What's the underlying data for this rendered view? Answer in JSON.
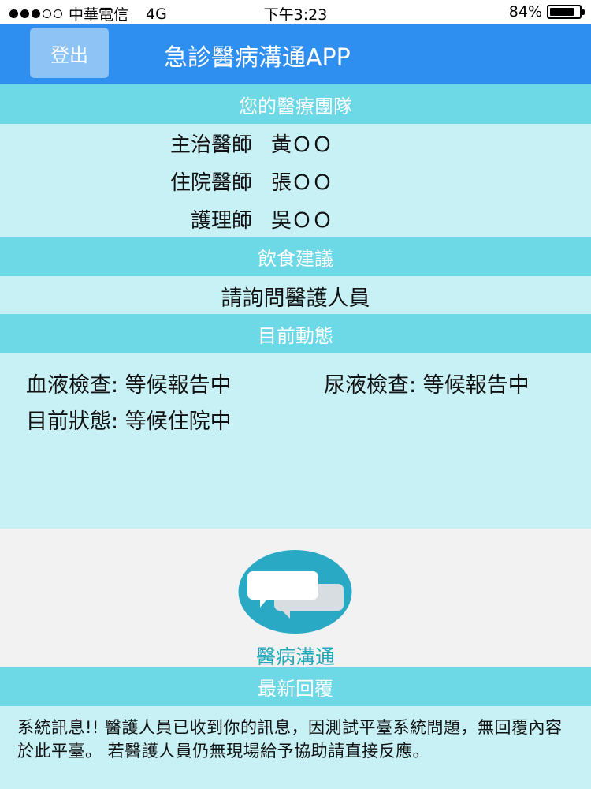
{
  "status_bar": {
    "carrier": "中華電信",
    "network": "4G",
    "time": "下午3:23",
    "battery_percent": "84%",
    "battery_level": 0.84,
    "signal_strength": 3
  },
  "header": {
    "logout_label": "登出",
    "title": "急診醫病溝通APP",
    "color": "#2f8ff0"
  },
  "team": {
    "heading": "您的醫療團隊",
    "members": [
      {
        "role": "主治醫師",
        "name": "黃ＯＯ"
      },
      {
        "role": "住院醫師",
        "name": "張ＯＯ"
      },
      {
        "role": "護理師",
        "name": "吳ＯＯ"
      }
    ]
  },
  "diet": {
    "heading": "飲食建議",
    "text": "請詢問醫護人員"
  },
  "current_status": {
    "heading": "目前動態",
    "blood_test": "血液檢查: 等候報告中",
    "urine_test": "尿液檢查: 等候報告中",
    "state": "目前狀態: 等候住院中"
  },
  "chat": {
    "label": "醫病溝通",
    "icon": "chat-bubbles-icon"
  },
  "latest_reply": {
    "heading": "最新回覆",
    "message": "系統訊息!! 醫護人員已收到你的訊息，因測試平臺系統問題，無回覆內容於此平臺。 若醫護人員仍無現場給予協助請直接反應。"
  },
  "colors": {
    "section_header": "#6dd8e6",
    "section_body": "#c8f1f6",
    "chat_circle": "#2aa9c4"
  }
}
